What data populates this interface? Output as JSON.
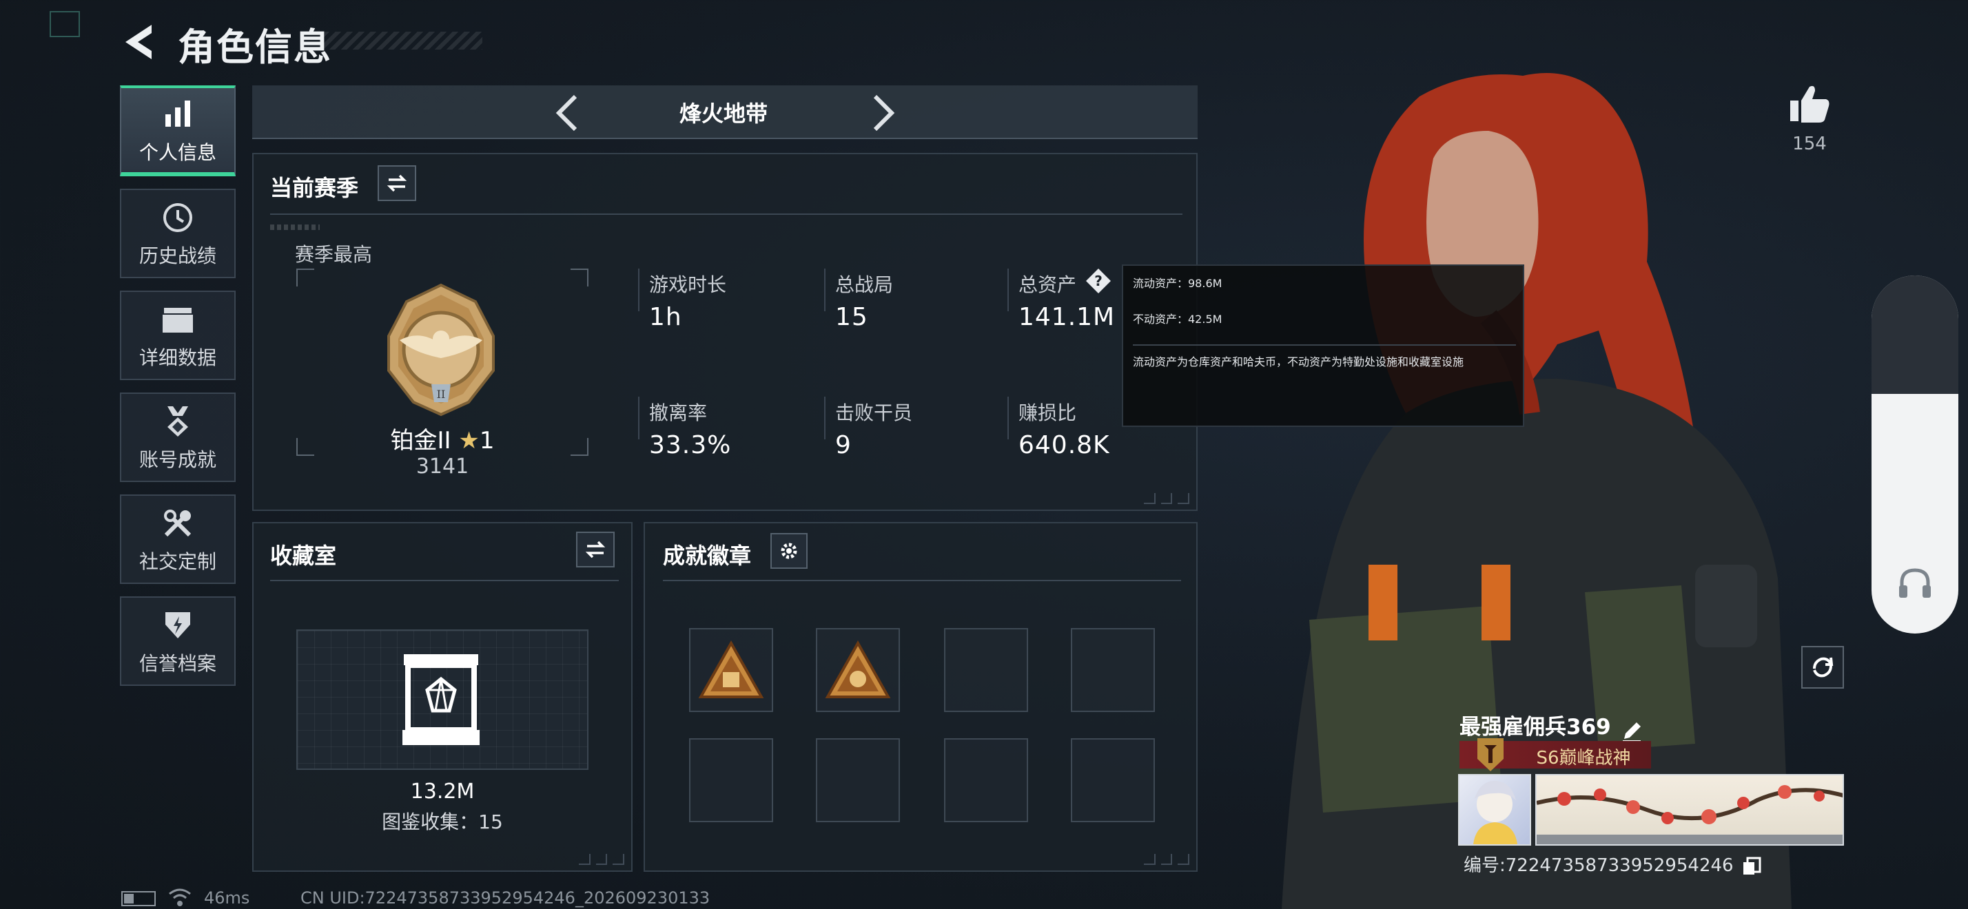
{
  "header": {
    "title": "角色信息"
  },
  "sidebar": {
    "items": [
      {
        "label": "个人信息"
      },
      {
        "label": "历史战绩"
      },
      {
        "label": "详细数据"
      },
      {
        "label": "账号成就"
      },
      {
        "label": "社交定制"
      },
      {
        "label": "信誉档案"
      }
    ]
  },
  "mode": {
    "title": "烽火地带"
  },
  "season": {
    "title": "当前赛季",
    "best_label": "赛季最高",
    "rank_name": "铂金II",
    "rank_stars": "1",
    "rank_score": "3141",
    "stats": [
      {
        "label": "游戏时长",
        "value": "1h"
      },
      {
        "label": "总战局",
        "value": "15"
      },
      {
        "label": "总资产",
        "value": "141.1M"
      },
      {
        "label": "撤离率",
        "value": "33.3%"
      },
      {
        "label": "击败干员",
        "value": "9"
      },
      {
        "label": "赚损比",
        "value": "640.8K"
      }
    ]
  },
  "tooltip": {
    "liquid": "流动资产：98.6M",
    "fixed": "不动资产：42.5M",
    "description": "流动资产为仓库资产和哈夫币，不动资产为特勤处设施和收藏室设施"
  },
  "collection": {
    "title": "收藏室",
    "value": "13.2M",
    "catalog": "图鉴收集：15"
  },
  "achievements": {
    "title": "成就徽章"
  },
  "right": {
    "like_count": "154",
    "player_name": "最强雇佣兵369",
    "player_title": "S6巅峰战神",
    "player_id": "编号:722473587339529542​46"
  },
  "footer": {
    "ping": "46ms",
    "uid": "CN UID:722473587339529542​46_202609230133"
  },
  "colors": {
    "accent": "#3ed49a",
    "title_bar": "#7a1f24",
    "panel_border": "#34404b"
  }
}
